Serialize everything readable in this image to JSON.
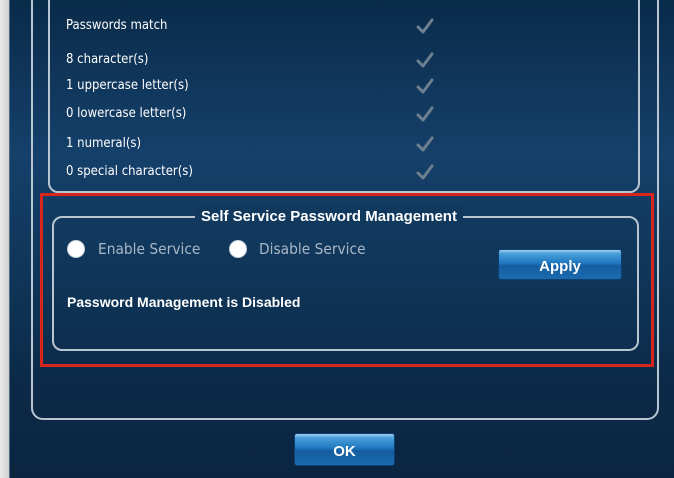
{
  "requirements": [
    {
      "label": "Passwords match"
    },
    {
      "label": "8 character(s)"
    },
    {
      "label": "1 uppercase letter(s)"
    },
    {
      "label": "0 lowercase letter(s)"
    },
    {
      "label": "1 numeral(s)"
    },
    {
      "label": "0 special character(s)"
    }
  ],
  "self_service": {
    "title": "Self Service Password Management",
    "enable_label": "Enable Service",
    "disable_label": "Disable Service",
    "apply_label": "Apply",
    "status": "Password Management is Disabled"
  },
  "dialog": {
    "ok_label": "OK"
  },
  "colors": {
    "highlight": "#d9261c",
    "check": "#7d8c9c"
  }
}
